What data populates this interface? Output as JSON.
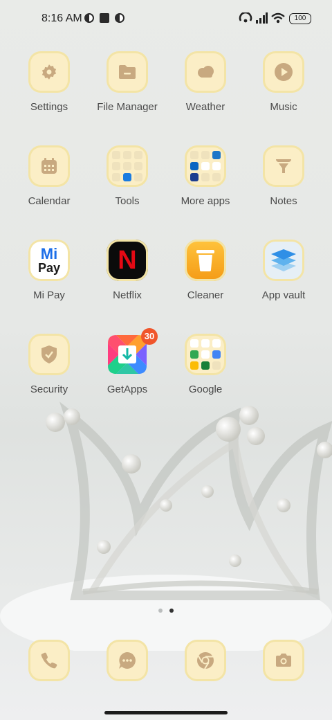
{
  "status_bar": {
    "time": "8:16 AM",
    "battery": "100",
    "icons": [
      "app-notification-icon",
      "stop-square-icon",
      "app-notification-icon-2",
      "hotspot-icon",
      "signal-icon",
      "wifi-icon",
      "battery-icon"
    ]
  },
  "apps": [
    {
      "label": "Settings",
      "icon": "gear-icon"
    },
    {
      "label": "File Manager",
      "icon": "folder-icon"
    },
    {
      "label": "Weather",
      "icon": "cloud-icon"
    },
    {
      "label": "Music",
      "icon": "play-icon"
    },
    {
      "label": "Calendar",
      "icon": "calendar-icon"
    },
    {
      "label": "Tools",
      "icon": "folder-icon"
    },
    {
      "label": "More apps",
      "icon": "folder-icon"
    },
    {
      "label": "Notes",
      "icon": "notes-funnel-icon"
    },
    {
      "label": "Mi Pay",
      "icon": "mi-pay-logo-icon",
      "logo_text": [
        "Mi",
        "Pay"
      ]
    },
    {
      "label": "Netflix",
      "icon": "netflix-logo-icon",
      "logo_text": "N"
    },
    {
      "label": "Cleaner",
      "icon": "trash-can-icon"
    },
    {
      "label": "App vault",
      "icon": "app-vault-icon"
    },
    {
      "label": "Security",
      "icon": "shield-check-icon"
    },
    {
      "label": "GetApps",
      "icon": "getapps-download-icon",
      "badge": "30"
    },
    {
      "label": "Google",
      "icon": "folder-icon"
    }
  ],
  "dock": [
    {
      "name": "phone",
      "icon": "phone-icon"
    },
    {
      "name": "messages",
      "icon": "chat-bubble-icon"
    },
    {
      "name": "browser",
      "icon": "chrome-icon"
    },
    {
      "name": "camera",
      "icon": "camera-icon"
    }
  ],
  "page_indicator": {
    "pages": 2,
    "current": 2
  },
  "colors": {
    "tile": "#fbeec6",
    "tile_border": "#f3e4a6",
    "glyph": "#c8a980",
    "badge": "#f0552b"
  }
}
